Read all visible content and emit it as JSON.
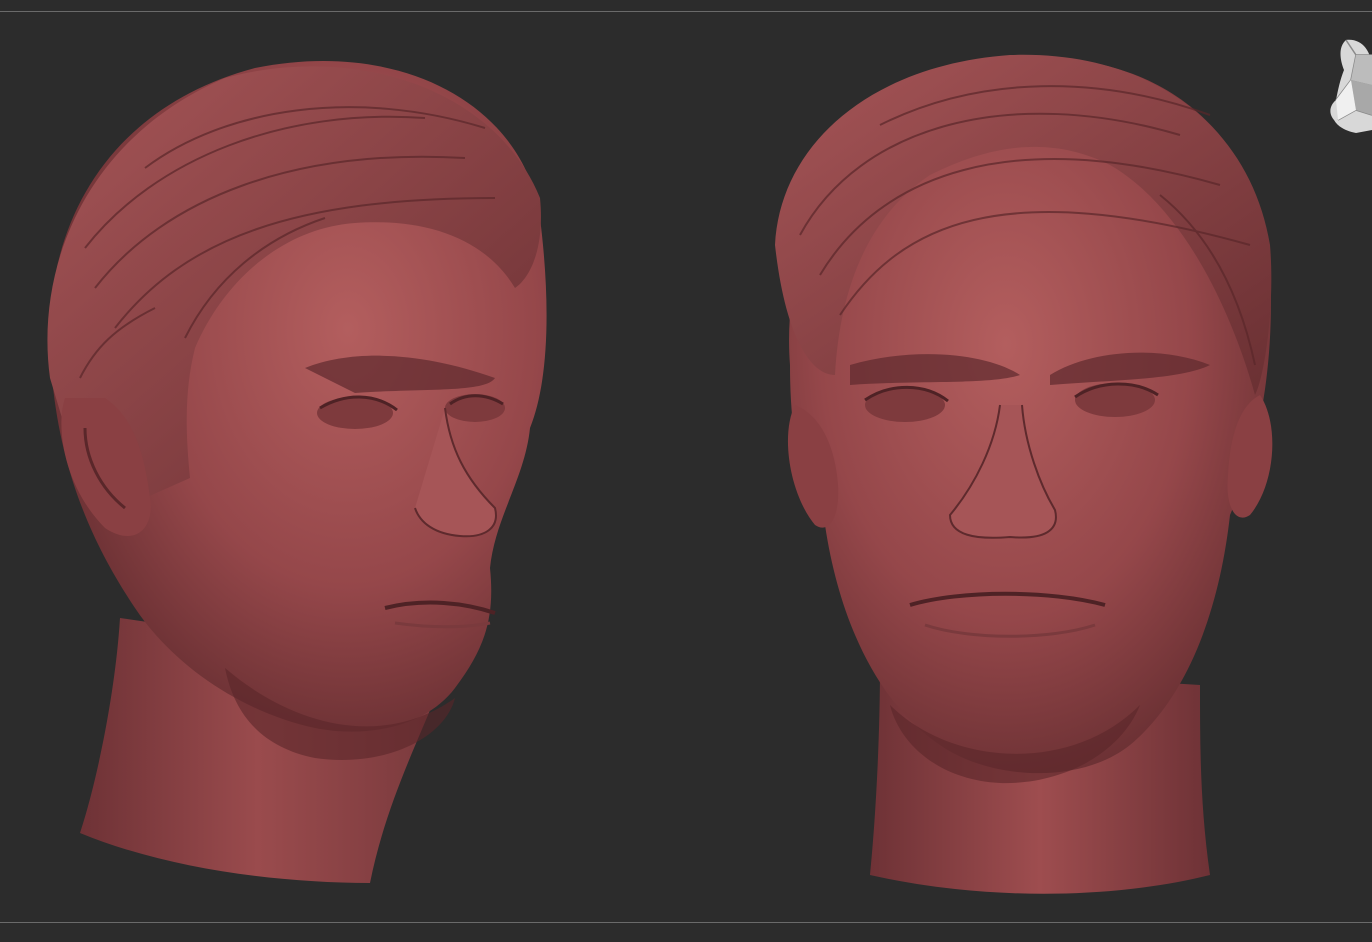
{
  "viewport": {
    "background": "#2c2c2c",
    "frame_line_color": "#6a6a6a"
  },
  "models": [
    {
      "name": "head-sculpt-three-quarter-view",
      "material_color": "#9b4a4a"
    },
    {
      "name": "head-sculpt-front-view",
      "material_color": "#9b4a4a"
    }
  ],
  "navigation": {
    "icon": "navigation-head-icon"
  }
}
